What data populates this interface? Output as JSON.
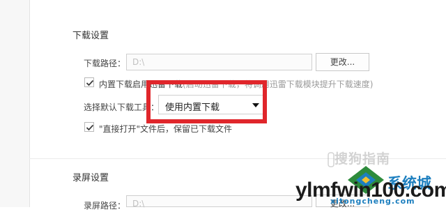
{
  "download_settings": {
    "title": "下载设置",
    "path_label": "下载路径：",
    "path_value": "D:\\",
    "change_button": "更改...",
    "builtin_checkbox_label": "内置下载启用迅雷下载",
    "builtin_checkbox_hint": "(启动迅雷下载，将调用迅雷下载模块提升下载速度)",
    "builtin_checked": true,
    "default_tool_label": "选择默认下载工具：",
    "default_tool_value": "使用内置下载",
    "open_checkbox_label": "\"直接打开\"文件后，保留已下载文件",
    "open_checked": true
  },
  "record_settings": {
    "title": "录屏设置",
    "path_label": "录屏路径：",
    "path_value": "D:\\",
    "change_button": "更改..."
  },
  "watermarks": {
    "sogou": "搜狗指南",
    "site_cn": "系统城",
    "site_domain": "ylmfwin100.com",
    "site_pinyin": "xitongcheng.com"
  },
  "colors": {
    "highlight": "#e0262b",
    "brand_blue": "#1d7fbf"
  }
}
